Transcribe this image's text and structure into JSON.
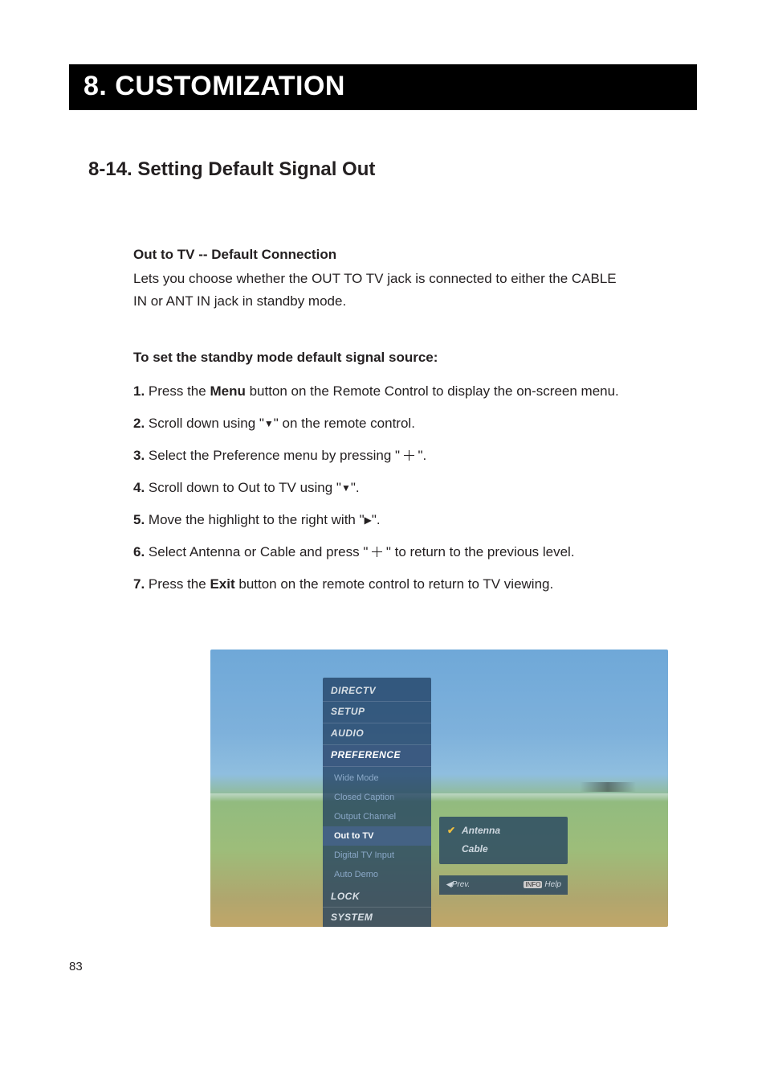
{
  "chapter_title": "8. CUSTOMIZATION",
  "section_title": "8-14. Setting Default Signal Out",
  "sub_head": "Out to TV -- Default Connection",
  "intro_text": "Lets you choose whether the OUT TO TV jack is connected to either the CABLE IN or ANT IN jack in standby mode.",
  "sub_head2": "To set the standby mode default signal source:",
  "steps": [
    {
      "num": "1.",
      "pre": "Press the ",
      "bold": "Menu",
      "post": " button on the Remote Control to display the on-screen menu."
    },
    {
      "num": "2.",
      "pre": "Scroll down using \"",
      "glyph": "▼",
      "post": "\" on the remote control."
    },
    {
      "num": "3.",
      "pre": "Select the Preference menu by pressing \" ",
      "select_glyph": true,
      "post": " \"."
    },
    {
      "num": "4.",
      "pre": "Scroll down to Out to TV using \"",
      "glyph": "▼",
      "post": "\"."
    },
    {
      "num": "5.",
      "pre": "Move the highlight to the right with \"",
      "glyph": "▶",
      "post": "\"."
    },
    {
      "num": "6.",
      "pre": "Select Antenna or Cable and press \" ",
      "select_glyph": true,
      "post": " \" to return to the previous level."
    },
    {
      "num": "7.",
      "pre": "Press the ",
      "bold": "Exit",
      "post": " button on the remote control to return to TV viewing."
    }
  ],
  "tv_menu": {
    "top_items": [
      "DIRECTV",
      "SETUP",
      "AUDIO"
    ],
    "selected": "PREFERENCE",
    "sub_items": [
      {
        "label": "Wide Mode",
        "highlight": false
      },
      {
        "label": "Closed Caption",
        "highlight": false
      },
      {
        "label": "Output Channel",
        "highlight": false
      },
      {
        "label": "Out to TV",
        "highlight": true
      },
      {
        "label": "Digital TV Input",
        "highlight": false
      },
      {
        "label": "Auto Demo",
        "highlight": false
      }
    ],
    "bottom_items": [
      "LOCK",
      "SYSTEM"
    ],
    "options": [
      {
        "label": "Antenna",
        "checked": true
      },
      {
        "label": "Cable",
        "checked": false
      }
    ],
    "footer_left": "◀Prev.",
    "footer_right_badge": "INFO",
    "footer_right": "Help"
  },
  "page_number": "83"
}
